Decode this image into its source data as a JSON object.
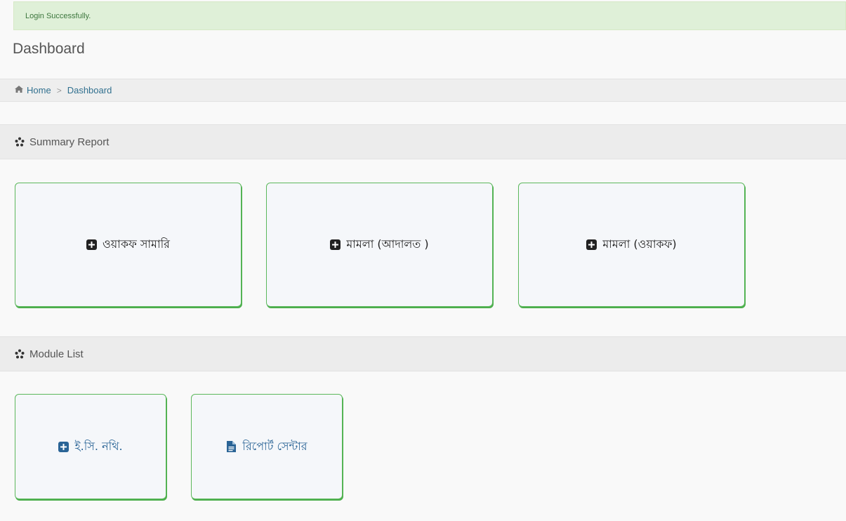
{
  "alert": {
    "message": "Login Successfully."
  },
  "page": {
    "title": "Dashboard"
  },
  "breadcrumb": {
    "home": "Home",
    "separator": ">",
    "current": "Dashboard"
  },
  "summary": {
    "header": "Summary Report",
    "cards": [
      {
        "label": "ওয়াকফ সামারি",
        "icon": "plus-square-icon"
      },
      {
        "label": "মামলা (আদালত )",
        "icon": "plus-square-icon"
      },
      {
        "label": "মামলা (ওয়াকফ)",
        "icon": "plus-square-icon"
      }
    ]
  },
  "modules": {
    "header": "Module List",
    "cards": [
      {
        "label": "ই.সি. নথি.",
        "icon": "plus-square-icon"
      },
      {
        "label": "রিপোর্ট সেন্টার",
        "icon": "file-text-icon"
      }
    ]
  },
  "colors": {
    "alert_bg": "#dff0d8",
    "alert_text": "#3c763d",
    "card_border": "#5cb85c",
    "link": "#31708f",
    "module_text": "#2a6496"
  }
}
